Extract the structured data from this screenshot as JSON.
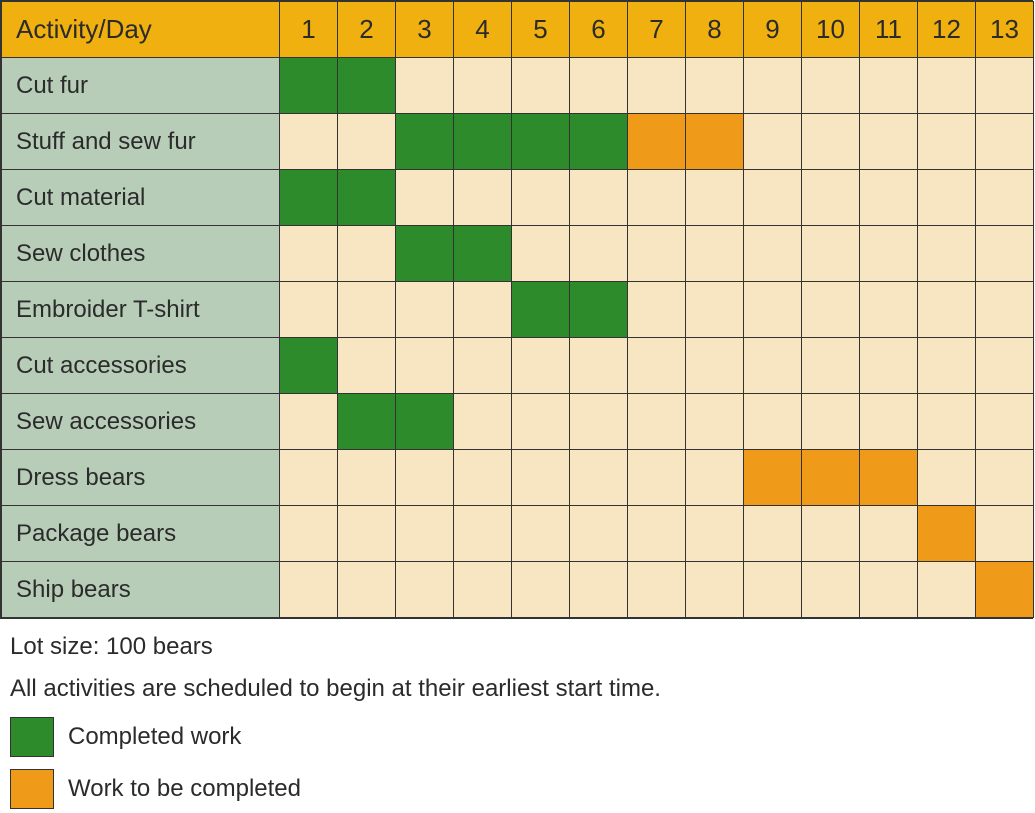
{
  "chart_data": {
    "type": "table",
    "header_label": "Activity/Day",
    "days": [
      "1",
      "2",
      "3",
      "4",
      "5",
      "6",
      "7",
      "8",
      "9",
      "10",
      "11",
      "12",
      "13"
    ],
    "status_codes": {
      "": "empty",
      "C": "completed",
      "T": "todo"
    },
    "activities": [
      {
        "name": "Cut fur",
        "cells": [
          "C",
          "C",
          "",
          "",
          "",
          "",
          "",
          "",
          "",
          "",
          "",
          "",
          ""
        ]
      },
      {
        "name": "Stuff and sew fur",
        "cells": [
          "",
          "",
          "C",
          "C",
          "C",
          "C",
          "T",
          "T",
          "",
          "",
          "",
          "",
          ""
        ]
      },
      {
        "name": "Cut material",
        "cells": [
          "C",
          "C",
          "",
          "",
          "",
          "",
          "",
          "",
          "",
          "",
          "",
          "",
          ""
        ]
      },
      {
        "name": "Sew clothes",
        "cells": [
          "",
          "",
          "C",
          "C",
          "",
          "",
          "",
          "",
          "",
          "",
          "",
          "",
          ""
        ]
      },
      {
        "name": "Embroider T-shirt",
        "cells": [
          "",
          "",
          "",
          "",
          "C",
          "C",
          "",
          "",
          "",
          "",
          "",
          "",
          ""
        ]
      },
      {
        "name": "Cut accessories",
        "cells": [
          "C",
          "",
          "",
          "",
          "",
          "",
          "",
          "",
          "",
          "",
          "",
          "",
          ""
        ]
      },
      {
        "name": "Sew accessories",
        "cells": [
          "",
          "C",
          "C",
          "",
          "",
          "",
          "",
          "",
          "",
          "",
          "",
          "",
          ""
        ]
      },
      {
        "name": "Dress bears",
        "cells": [
          "",
          "",
          "",
          "",
          "",
          "",
          "",
          "",
          "T",
          "T",
          "T",
          "",
          ""
        ]
      },
      {
        "name": "Package bears",
        "cells": [
          "",
          "",
          "",
          "",
          "",
          "",
          "",
          "",
          "",
          "",
          "",
          "T",
          ""
        ]
      },
      {
        "name": "Ship bears",
        "cells": [
          "",
          "",
          "",
          "",
          "",
          "",
          "",
          "",
          "",
          "",
          "",
          "",
          "T"
        ]
      }
    ]
  },
  "footer": {
    "lot_size": "Lot size: 100 bears",
    "note": "All activities are scheduled to begin at their earliest start time.",
    "legend_completed": "Completed work",
    "legend_todo": "Work to be completed"
  },
  "colors": {
    "header_bg": "#f0b010",
    "activity_bg": "#b7cdb8",
    "empty_cell": "#f8e6c2",
    "completed": "#2e8b2b",
    "todo": "#f09a1a"
  }
}
